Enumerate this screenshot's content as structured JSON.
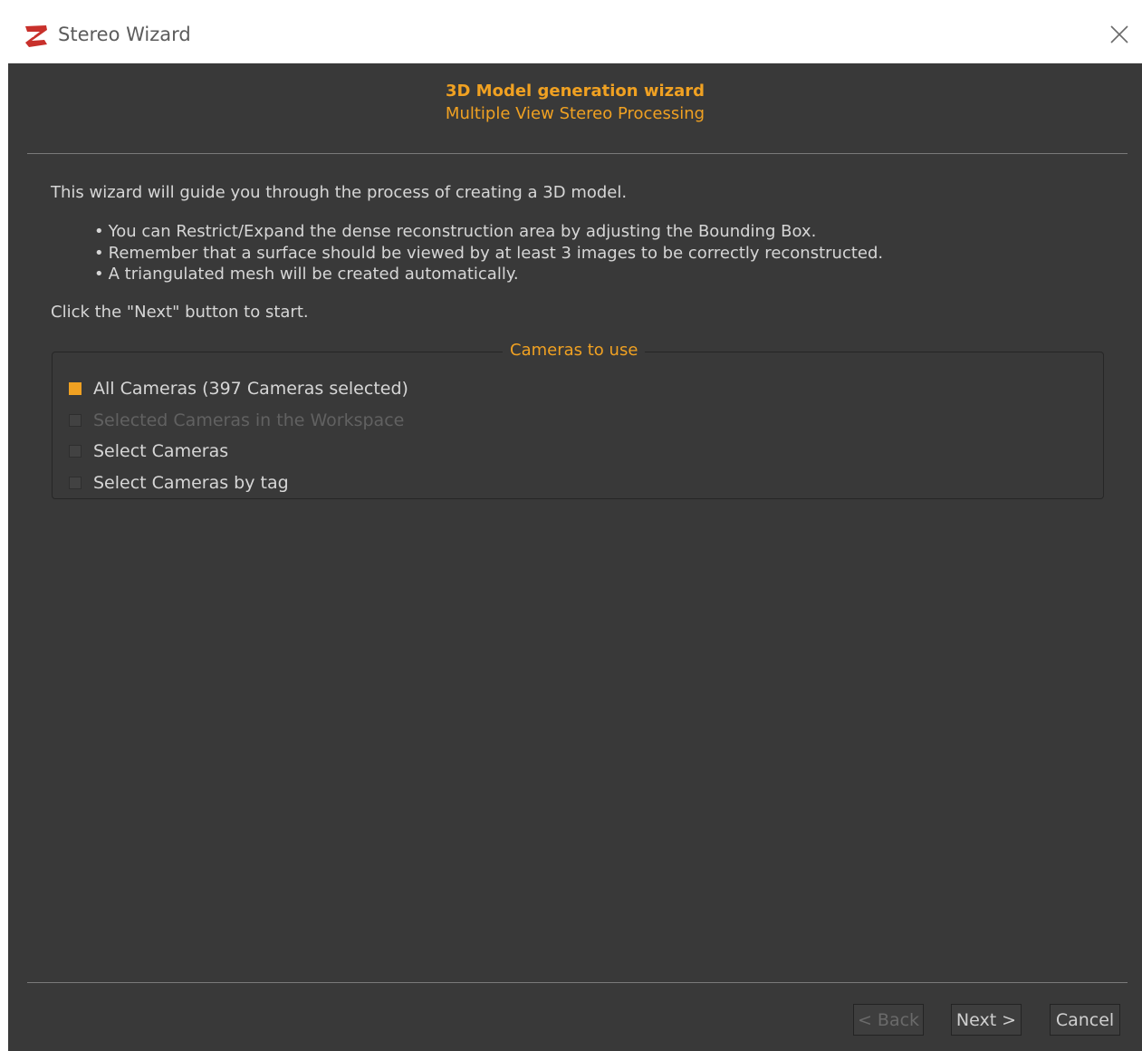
{
  "window": {
    "title": "Stereo Wizard",
    "app_icon": "3dflow-zephyr-logo-icon",
    "close_icon": "close-icon"
  },
  "header": {
    "title": "3D Model generation wizard",
    "subtitle": "Multiple View Stereo Processing"
  },
  "body": {
    "intro": "This wizard will guide you through the process of creating a 3D model.",
    "bullets": [
      "You can Restrict/Expand the dense reconstruction area by adjusting the Bounding Box.",
      "Remember that a surface should be viewed by at least 3 images to be correctly reconstructed.",
      "A triangulated mesh will be created automatically."
    ],
    "instruction": "Click the \"Next\" button to start."
  },
  "cameras_group": {
    "legend": "Cameras to use",
    "options": [
      {
        "label": "All Cameras (397 Cameras selected)",
        "checked": true,
        "enabled": true
      },
      {
        "label": "Selected Cameras in the Workspace",
        "checked": false,
        "enabled": false
      },
      {
        "label": "Select Cameras",
        "checked": false,
        "enabled": true
      },
      {
        "label": "Select Cameras by tag",
        "checked": false,
        "enabled": true
      }
    ]
  },
  "footer": {
    "back_label": "< Back",
    "next_label": "Next >",
    "cancel_label": "Cancel"
  },
  "colors": {
    "accent": "#f0a122",
    "background": "#393939",
    "text": "#d6d6d6",
    "disabled_text": "#616161"
  }
}
